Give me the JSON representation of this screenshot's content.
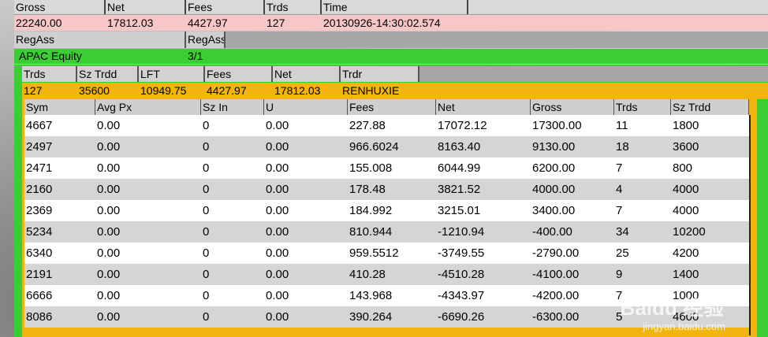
{
  "summary": {
    "headers": [
      "Gross",
      "Net",
      "Fees",
      "Trds",
      "Time"
    ],
    "values": [
      "22240.00",
      "17812.03",
      "4427.97",
      "127",
      "20130926-14:30:02.574"
    ]
  },
  "regass": {
    "labels": [
      "RegAss",
      "RegAss"
    ]
  },
  "group": {
    "name": "APAC Equity",
    "ratio": "3/1"
  },
  "trader": {
    "headers": [
      "Trds",
      "Sz Trdd",
      "LFT",
      "Fees",
      "Net",
      "Trdr"
    ],
    "values": [
      "127",
      "35600",
      "10949.75",
      "4427.97",
      "17812.03",
      "RENHUXIE"
    ]
  },
  "symbols": {
    "headers": [
      "Sym",
      "Avg Px",
      "Sz In",
      "U",
      "Fees",
      "Net",
      "Gross",
      "Trds",
      "Sz Trdd"
    ],
    "rows": [
      [
        "4667",
        "0.00",
        "0",
        "0.00",
        "227.88",
        "17072.12",
        "17300.00",
        "11",
        "1800"
      ],
      [
        "2497",
        "0.00",
        "0",
        "0.00",
        "966.6024",
        "8163.40",
        "9130.00",
        "18",
        "3600"
      ],
      [
        "2471",
        "0.00",
        "0",
        "0.00",
        "155.008",
        "6044.99",
        "6200.00",
        "7",
        "800"
      ],
      [
        "2160",
        "0.00",
        "0",
        "0.00",
        "178.48",
        "3821.52",
        "4000.00",
        "4",
        "4000"
      ],
      [
        "2369",
        "0.00",
        "0",
        "0.00",
        "184.992",
        "3215.01",
        "3400.00",
        "7",
        "4000"
      ],
      [
        "5234",
        "0.00",
        "0",
        "0.00",
        "810.944",
        "-1210.94",
        "-400.00",
        "34",
        "10200"
      ],
      [
        "6340",
        "0.00",
        "0",
        "0.00",
        "959.5512",
        "-3749.55",
        "-2790.00",
        "25",
        "4200"
      ],
      [
        "2191",
        "0.00",
        "0",
        "0.00",
        "410.28",
        "-4510.28",
        "-4100.00",
        "9",
        "1400"
      ],
      [
        "6666",
        "0.00",
        "0",
        "0.00",
        "143.968",
        "-4343.97",
        "-4200.00",
        "7",
        "1000"
      ],
      [
        "8086",
        "0.00",
        "0",
        "0.00",
        "390.264",
        "-6690.26",
        "-6300.00",
        "5",
        "4600"
      ]
    ]
  },
  "watermark": {
    "text": "Baidu 经验",
    "url": "jingyan.baidu.com"
  }
}
